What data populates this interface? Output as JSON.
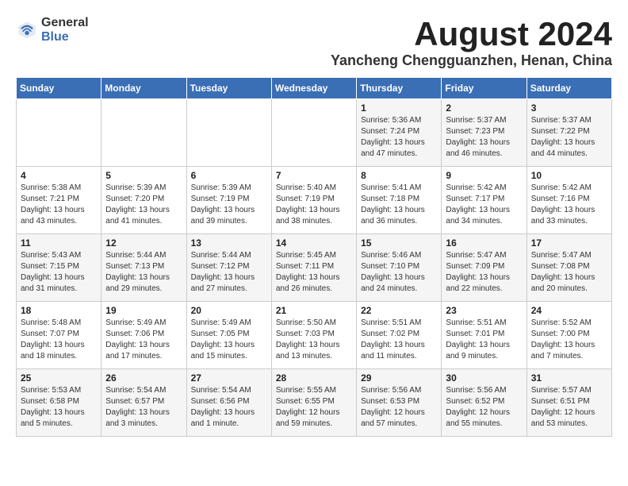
{
  "logo": {
    "general": "General",
    "blue": "Blue"
  },
  "title": {
    "month_year": "August 2024",
    "location": "Yancheng Chengguanzhen, Henan, China"
  },
  "weekdays": [
    "Sunday",
    "Monday",
    "Tuesday",
    "Wednesday",
    "Thursday",
    "Friday",
    "Saturday"
  ],
  "weeks": [
    [
      {
        "day": "",
        "sunrise": "",
        "sunset": "",
        "daylight": ""
      },
      {
        "day": "",
        "sunrise": "",
        "sunset": "",
        "daylight": ""
      },
      {
        "day": "",
        "sunrise": "",
        "sunset": "",
        "daylight": ""
      },
      {
        "day": "",
        "sunrise": "",
        "sunset": "",
        "daylight": ""
      },
      {
        "day": "1",
        "sunrise": "Sunrise: 5:36 AM",
        "sunset": "Sunset: 7:24 PM",
        "daylight": "Daylight: 13 hours and 47 minutes."
      },
      {
        "day": "2",
        "sunrise": "Sunrise: 5:37 AM",
        "sunset": "Sunset: 7:23 PM",
        "daylight": "Daylight: 13 hours and 46 minutes."
      },
      {
        "day": "3",
        "sunrise": "Sunrise: 5:37 AM",
        "sunset": "Sunset: 7:22 PM",
        "daylight": "Daylight: 13 hours and 44 minutes."
      }
    ],
    [
      {
        "day": "4",
        "sunrise": "Sunrise: 5:38 AM",
        "sunset": "Sunset: 7:21 PM",
        "daylight": "Daylight: 13 hours and 43 minutes."
      },
      {
        "day": "5",
        "sunrise": "Sunrise: 5:39 AM",
        "sunset": "Sunset: 7:20 PM",
        "daylight": "Daylight: 13 hours and 41 minutes."
      },
      {
        "day": "6",
        "sunrise": "Sunrise: 5:39 AM",
        "sunset": "Sunset: 7:19 PM",
        "daylight": "Daylight: 13 hours and 39 minutes."
      },
      {
        "day": "7",
        "sunrise": "Sunrise: 5:40 AM",
        "sunset": "Sunset: 7:19 PM",
        "daylight": "Daylight: 13 hours and 38 minutes."
      },
      {
        "day": "8",
        "sunrise": "Sunrise: 5:41 AM",
        "sunset": "Sunset: 7:18 PM",
        "daylight": "Daylight: 13 hours and 36 minutes."
      },
      {
        "day": "9",
        "sunrise": "Sunrise: 5:42 AM",
        "sunset": "Sunset: 7:17 PM",
        "daylight": "Daylight: 13 hours and 34 minutes."
      },
      {
        "day": "10",
        "sunrise": "Sunrise: 5:42 AM",
        "sunset": "Sunset: 7:16 PM",
        "daylight": "Daylight: 13 hours and 33 minutes."
      }
    ],
    [
      {
        "day": "11",
        "sunrise": "Sunrise: 5:43 AM",
        "sunset": "Sunset: 7:15 PM",
        "daylight": "Daylight: 13 hours and 31 minutes."
      },
      {
        "day": "12",
        "sunrise": "Sunrise: 5:44 AM",
        "sunset": "Sunset: 7:13 PM",
        "daylight": "Daylight: 13 hours and 29 minutes."
      },
      {
        "day": "13",
        "sunrise": "Sunrise: 5:44 AM",
        "sunset": "Sunset: 7:12 PM",
        "daylight": "Daylight: 13 hours and 27 minutes."
      },
      {
        "day": "14",
        "sunrise": "Sunrise: 5:45 AM",
        "sunset": "Sunset: 7:11 PM",
        "daylight": "Daylight: 13 hours and 26 minutes."
      },
      {
        "day": "15",
        "sunrise": "Sunrise: 5:46 AM",
        "sunset": "Sunset: 7:10 PM",
        "daylight": "Daylight: 13 hours and 24 minutes."
      },
      {
        "day": "16",
        "sunrise": "Sunrise: 5:47 AM",
        "sunset": "Sunset: 7:09 PM",
        "daylight": "Daylight: 13 hours and 22 minutes."
      },
      {
        "day": "17",
        "sunrise": "Sunrise: 5:47 AM",
        "sunset": "Sunset: 7:08 PM",
        "daylight": "Daylight: 13 hours and 20 minutes."
      }
    ],
    [
      {
        "day": "18",
        "sunrise": "Sunrise: 5:48 AM",
        "sunset": "Sunset: 7:07 PM",
        "daylight": "Daylight: 13 hours and 18 minutes."
      },
      {
        "day": "19",
        "sunrise": "Sunrise: 5:49 AM",
        "sunset": "Sunset: 7:06 PM",
        "daylight": "Daylight: 13 hours and 17 minutes."
      },
      {
        "day": "20",
        "sunrise": "Sunrise: 5:49 AM",
        "sunset": "Sunset: 7:05 PM",
        "daylight": "Daylight: 13 hours and 15 minutes."
      },
      {
        "day": "21",
        "sunrise": "Sunrise: 5:50 AM",
        "sunset": "Sunset: 7:03 PM",
        "daylight": "Daylight: 13 hours and 13 minutes."
      },
      {
        "day": "22",
        "sunrise": "Sunrise: 5:51 AM",
        "sunset": "Sunset: 7:02 PM",
        "daylight": "Daylight: 13 hours and 11 minutes."
      },
      {
        "day": "23",
        "sunrise": "Sunrise: 5:51 AM",
        "sunset": "Sunset: 7:01 PM",
        "daylight": "Daylight: 13 hours and 9 minutes."
      },
      {
        "day": "24",
        "sunrise": "Sunrise: 5:52 AM",
        "sunset": "Sunset: 7:00 PM",
        "daylight": "Daylight: 13 hours and 7 minutes."
      }
    ],
    [
      {
        "day": "25",
        "sunrise": "Sunrise: 5:53 AM",
        "sunset": "Sunset: 6:58 PM",
        "daylight": "Daylight: 13 hours and 5 minutes."
      },
      {
        "day": "26",
        "sunrise": "Sunrise: 5:54 AM",
        "sunset": "Sunset: 6:57 PM",
        "daylight": "Daylight: 13 hours and 3 minutes."
      },
      {
        "day": "27",
        "sunrise": "Sunrise: 5:54 AM",
        "sunset": "Sunset: 6:56 PM",
        "daylight": "Daylight: 13 hours and 1 minute."
      },
      {
        "day": "28",
        "sunrise": "Sunrise: 5:55 AM",
        "sunset": "Sunset: 6:55 PM",
        "daylight": "Daylight: 12 hours and 59 minutes."
      },
      {
        "day": "29",
        "sunrise": "Sunrise: 5:56 AM",
        "sunset": "Sunset: 6:53 PM",
        "daylight": "Daylight: 12 hours and 57 minutes."
      },
      {
        "day": "30",
        "sunrise": "Sunrise: 5:56 AM",
        "sunset": "Sunset: 6:52 PM",
        "daylight": "Daylight: 12 hours and 55 minutes."
      },
      {
        "day": "31",
        "sunrise": "Sunrise: 5:57 AM",
        "sunset": "Sunset: 6:51 PM",
        "daylight": "Daylight: 12 hours and 53 minutes."
      }
    ]
  ]
}
